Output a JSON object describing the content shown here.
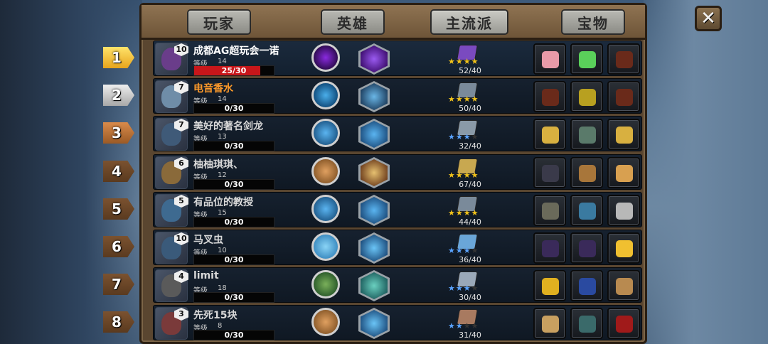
{
  "tabs": [
    {
      "label": "玩家"
    },
    {
      "label": "英雄"
    },
    {
      "label": "主流派"
    },
    {
      "label": "宝物"
    }
  ],
  "close_icon": "close-icon",
  "level_label": "等级",
  "rows": [
    {
      "rank": "1",
      "rank_style": "gold",
      "name": "成都AG超玩会一诺",
      "name_color": "white",
      "hero_level": "10",
      "player_level": "14",
      "xp_text": "25/30",
      "xp_fraction": 0.8333,
      "style_progress": "52/40",
      "stars": [
        1,
        1,
        1,
        1
      ],
      "star_color": "gold",
      "items": [
        "piggy-bank-icon",
        "potion-icon",
        "boot-icon"
      ]
    },
    {
      "rank": "2",
      "rank_style": "silver",
      "name": "电音香水",
      "name_color": "orange",
      "hero_level": "7",
      "player_level": "14",
      "xp_text": "0/30",
      "xp_fraction": 0,
      "style_progress": "50/40",
      "stars": [
        1,
        1,
        1,
        1
      ],
      "star_color": "gold",
      "items": [
        "boot-icon",
        "clover-icon",
        "boot-icon"
      ]
    },
    {
      "rank": "3",
      "rank_style": "bronze",
      "name": "美好的著名剑龙",
      "name_color": "grey",
      "hero_level": "7",
      "player_level": "13",
      "xp_text": "0/30",
      "xp_fraction": 0,
      "style_progress": "32/40",
      "stars": [
        1,
        1,
        1,
        0
      ],
      "star_color": "blue",
      "items": [
        "pocket-watch-icon",
        "staff-icon",
        "pocket-watch-icon"
      ]
    },
    {
      "rank": "4",
      "rank_style": "plain",
      "name": "柚柚琪琪、",
      "name_color": "grey",
      "hero_level": "6",
      "player_level": "12",
      "xp_text": "0/30",
      "xp_fraction": 0,
      "style_progress": "67/40",
      "stars": [
        1,
        1,
        1,
        1
      ],
      "star_color": "gold",
      "items": [
        "spellbook-icon",
        "chalice-icon",
        "ore-icon"
      ]
    },
    {
      "rank": "5",
      "rank_style": "plain",
      "name": "有品位的教授",
      "name_color": "grey",
      "hero_level": "5",
      "player_level": "15",
      "xp_text": "0/30",
      "xp_fraction": 0,
      "style_progress": "44/40",
      "stars": [
        1,
        1,
        1,
        1
      ],
      "star_color": "gold",
      "items": [
        "spear-icon",
        "lantern-icon",
        "ring-icon"
      ]
    },
    {
      "rank": "6",
      "rank_style": "plain",
      "name": "马叉虫",
      "name_color": "grey",
      "hero_level": "10",
      "player_level": "10",
      "xp_text": "0/30",
      "xp_fraction": 0,
      "style_progress": "36/40",
      "stars": [
        1,
        1,
        1,
        0
      ],
      "star_color": "blue",
      "items": [
        "dark-sword-icon",
        "dark-sword-icon",
        "gold-orb-icon"
      ]
    },
    {
      "rank": "7",
      "rank_style": "plain",
      "name": "limit",
      "name_color": "grey",
      "hero_level": "4",
      "player_level": "18",
      "xp_text": "0/30",
      "xp_fraction": 0,
      "style_progress": "30/40",
      "stars": [
        1,
        1,
        1,
        0
      ],
      "star_color": "blue",
      "items": [
        "gear-icon",
        "blue-gem-icon",
        "scroll-icon"
      ]
    },
    {
      "rank": "8",
      "rank_style": "plain",
      "name": "先死15块",
      "name_color": "grey",
      "hero_level": "3",
      "player_level": "8",
      "xp_text": "0/30",
      "xp_fraction": 0,
      "style_progress": "31/40",
      "stars": [
        1,
        1,
        0,
        0
      ],
      "star_color": "blue",
      "items": [
        "vip-card-icon",
        "crest-icon",
        "red-hood-icon"
      ]
    }
  ],
  "colors": {
    "xp_bar": "#c8161a",
    "gold_star": "#f2c31a",
    "blue_star": "#5aa3ff",
    "name_orange": "#ff9b2a"
  }
}
